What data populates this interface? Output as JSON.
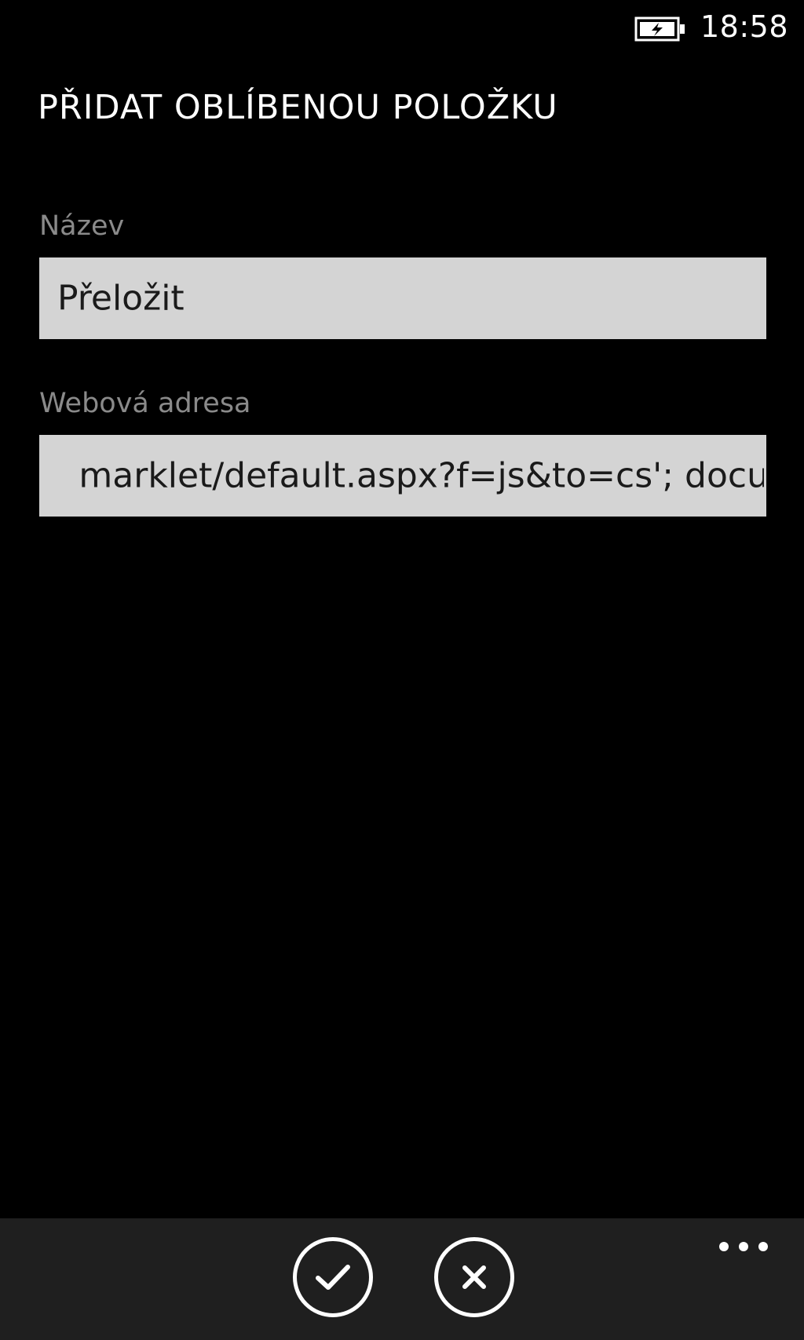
{
  "status_bar": {
    "time": "18:58",
    "battery_icon": "battery-charging-icon"
  },
  "page": {
    "title": "PŘIDAT OBLÍBENOU POLOŽKU"
  },
  "form": {
    "name": {
      "label": "Název",
      "value": "Přeložit"
    },
    "url": {
      "label": "Webová adresa",
      "value": "marklet/default.aspx?f=js&to=cs'; docu"
    }
  },
  "app_bar": {
    "buttons": [
      {
        "icon": "check-icon"
      },
      {
        "icon": "close-icon"
      }
    ],
    "more_icon": "more-dots-icon"
  },
  "colors": {
    "background": "#000000",
    "input_background": "#d4d4d4",
    "label": "#8a8a8a",
    "app_bar": "#1f1f1f",
    "foreground": "#ffffff"
  }
}
